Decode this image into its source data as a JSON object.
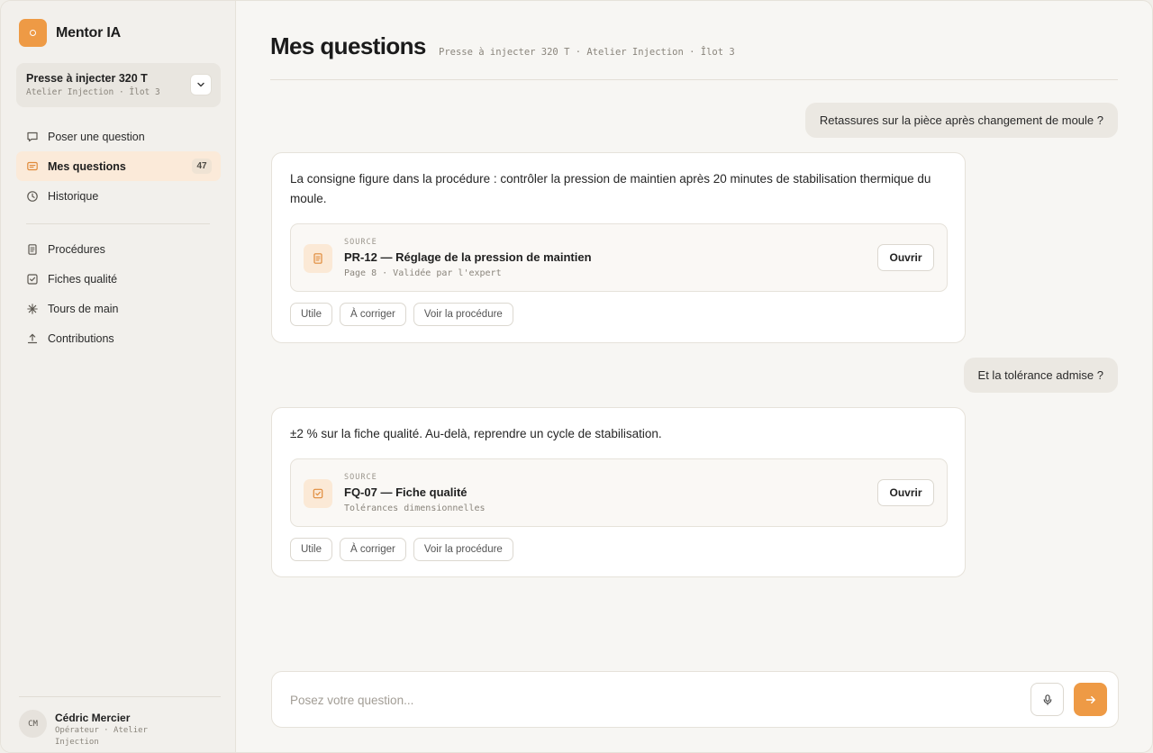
{
  "app": {
    "name": "Mentor IA"
  },
  "machine": {
    "name": "Presse à injecter 320 T",
    "location": "Atelier Injection · Îlot 3"
  },
  "nav": {
    "primary": [
      {
        "label": "Poser une question",
        "icon": "chat-bubble-icon"
      },
      {
        "label": "Mes questions",
        "icon": "message-square-icon",
        "badge": "47",
        "active": true
      },
      {
        "label": "Historique",
        "icon": "clock-icon"
      }
    ],
    "secondary": [
      {
        "label": "Procédures",
        "icon": "document-icon"
      },
      {
        "label": "Fiches qualité",
        "icon": "checkbox-icon"
      },
      {
        "label": "Tours de main",
        "icon": "sparkle-icon"
      },
      {
        "label": "Contributions",
        "icon": "upload-icon"
      }
    ]
  },
  "user": {
    "initials": "CM",
    "name": "Cédric Mercier",
    "role": "Opérateur · Atelier Injection"
  },
  "header": {
    "title": "Mes questions",
    "context": "Presse à injecter 320 T · Atelier Injection · Îlot 3"
  },
  "conversation": {
    "q1": "Retassures sur la pièce après changement de moule ?",
    "a1": {
      "text": "La consigne figure dans la procédure : contrôler la pression de maintien après 20 minutes de stabilisation thermique du moule.",
      "source_kicker": "SOURCE",
      "source_title": "PR-12 — Réglage de la pression de maintien",
      "source_meta": "Page 8 · Validée par l'expert",
      "source_icon": "document-icon",
      "open_label": "Ouvrir"
    },
    "q2": "Et la tolérance admise ?",
    "a2": {
      "text": "±2 % sur la fiche qualité. Au-delà, reprendre un cycle de stabilisation.",
      "source_kicker": "SOURCE",
      "source_title": "FQ-07 — Fiche qualité",
      "source_meta": "Tolérances dimensionnelles",
      "source_icon": "checkbox-icon",
      "open_label": "Ouvrir"
    },
    "actions": {
      "useful": "Utile",
      "correct": "À corriger",
      "view": "Voir la procédure"
    }
  },
  "composer": {
    "placeholder": "Posez votre question..."
  },
  "colors": {
    "accent": "#ee9a45",
    "active_bg": "#fbead9"
  }
}
